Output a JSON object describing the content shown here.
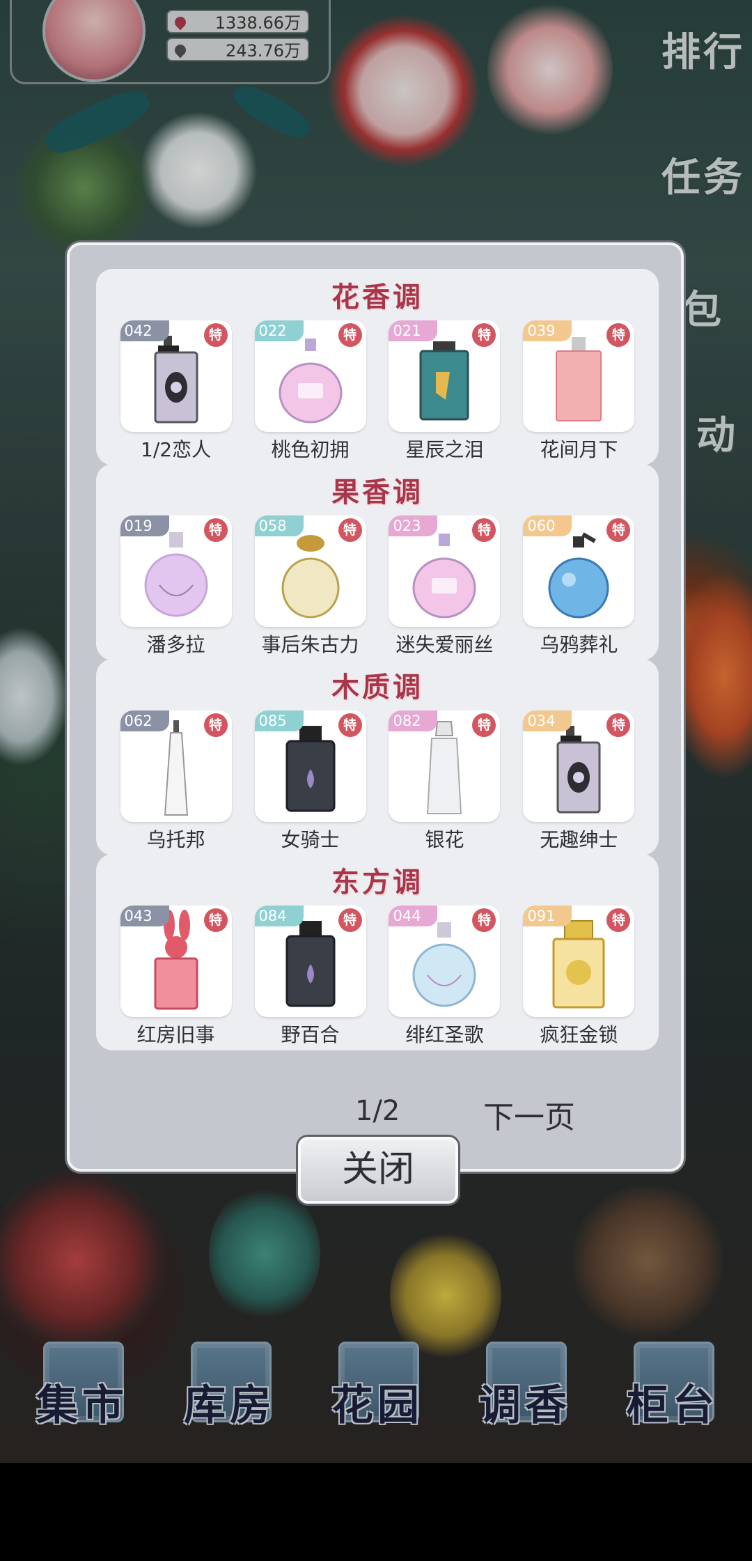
{
  "user": {
    "currency_1": "1338.66万",
    "currency_2": "243.76万"
  },
  "side_nav": [
    "排行",
    "任务",
    "包",
    "动"
  ],
  "modal": {
    "sections": [
      {
        "title": "花香调",
        "items": [
          {
            "number": "042",
            "badge": "特",
            "name": "1/2恋人",
            "number_color": "#8c92a6",
            "bottle": "dark-rect"
          },
          {
            "number": "022",
            "badge": "特",
            "name": "桃色初拥",
            "number_color": "#8fd1d3",
            "bottle": "round-pink"
          },
          {
            "number": "021",
            "badge": "特",
            "name": "星辰之泪",
            "number_color": "#e8a8d4",
            "bottle": "teal-square"
          },
          {
            "number": "039",
            "badge": "特",
            "name": "花间月下",
            "number_color": "#f3c88f",
            "bottle": "pink-rect"
          }
        ]
      },
      {
        "title": "果香调",
        "items": [
          {
            "number": "019",
            "badge": "特",
            "name": "潘多拉",
            "number_color": "#8c92a6",
            "bottle": "round-lilac"
          },
          {
            "number": "058",
            "badge": "特",
            "name": "事后朱古力",
            "number_color": "#8fd1d3",
            "bottle": "gold-round"
          },
          {
            "number": "023",
            "badge": "特",
            "name": "迷失爱丽丝",
            "number_color": "#e8a8d4",
            "bottle": "round-pink"
          },
          {
            "number": "060",
            "badge": "特",
            "name": "乌鸦葬礼",
            "number_color": "#f3c88f",
            "bottle": "blue-orb"
          }
        ]
      },
      {
        "title": "木质调",
        "items": [
          {
            "number": "062",
            "badge": "特",
            "name": "乌托邦",
            "number_color": "#8c92a6",
            "bottle": "slim-glass"
          },
          {
            "number": "085",
            "badge": "特",
            "name": "女骑士",
            "number_color": "#8fd1d3",
            "bottle": "dark-square"
          },
          {
            "number": "082",
            "badge": "特",
            "name": "银花",
            "number_color": "#e8a8d4",
            "bottle": "clear-tall"
          },
          {
            "number": "034",
            "badge": "特",
            "name": "无趣绅士",
            "number_color": "#f3c88f",
            "bottle": "dark-rect"
          }
        ]
      },
      {
        "title": "东方调",
        "items": [
          {
            "number": "043",
            "badge": "特",
            "name": "红房旧事",
            "number_color": "#8c92a6",
            "bottle": "bunny-red"
          },
          {
            "number": "084",
            "badge": "特",
            "name": "野百合",
            "number_color": "#8fd1d3",
            "bottle": "dark-square"
          },
          {
            "number": "044",
            "badge": "特",
            "name": "绯红圣歌",
            "number_color": "#e8a8d4",
            "bottle": "round-blue"
          },
          {
            "number": "091",
            "badge": "特",
            "name": "疯狂金锁",
            "number_color": "#f3c88f",
            "bottle": "gold-ornate"
          }
        ]
      }
    ],
    "pager": {
      "current": "1/2",
      "next_label": "下一页"
    },
    "close_label": "关闭"
  },
  "bottom_nav": [
    "集市",
    "库房",
    "花园",
    "调香",
    "柜台"
  ]
}
